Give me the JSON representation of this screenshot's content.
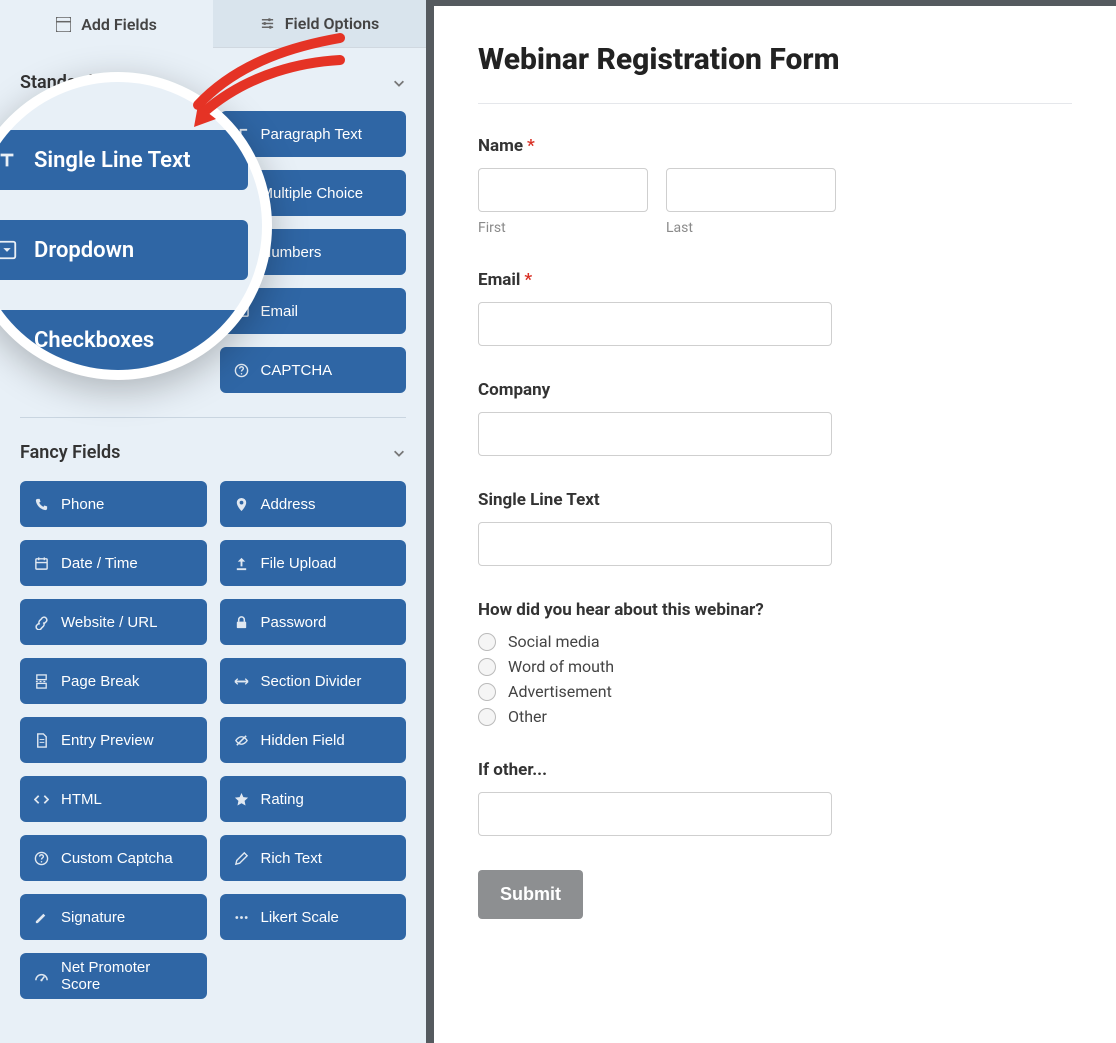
{
  "tabs": {
    "add_fields": "Add Fields",
    "field_options": "Field Options"
  },
  "sections": {
    "standard": "Standard Fields",
    "fancy": "Fancy Fields"
  },
  "standard_fields": {
    "paragraph": "Paragraph Text",
    "multiple_choice": "Multiple Choice",
    "numbers": "Numbers",
    "email": "Email",
    "captcha": "CAPTCHA"
  },
  "zoomed": {
    "single_line": "Single Line Text",
    "dropdown": "Dropdown",
    "checkboxes": "Checkboxes"
  },
  "fancy_fields": {
    "phone": "Phone",
    "address": "Address",
    "datetime": "Date / Time",
    "file_upload": "File Upload",
    "website": "Website / URL",
    "password": "Password",
    "page_break": "Page Break",
    "section_divider": "Section Divider",
    "entry_preview": "Entry Preview",
    "hidden_field": "Hidden Field",
    "html": "HTML",
    "rating": "Rating",
    "custom_captcha": "Custom Captcha",
    "rich_text": "Rich Text",
    "signature": "Signature",
    "likert": "Likert Scale",
    "nps": "Net Promoter Score"
  },
  "form": {
    "title": "Webinar Registration Form",
    "name_label": "Name",
    "first_sub": "First",
    "last_sub": "Last",
    "email_label": "Email",
    "company_label": "Company",
    "single_line_label": "Single Line Text",
    "hear_label": "How did you hear about this webinar?",
    "options": {
      "social": "Social media",
      "word": "Word of mouth",
      "ad": "Advertisement",
      "other": "Other"
    },
    "if_other_label": "If other...",
    "submit": "Submit"
  }
}
